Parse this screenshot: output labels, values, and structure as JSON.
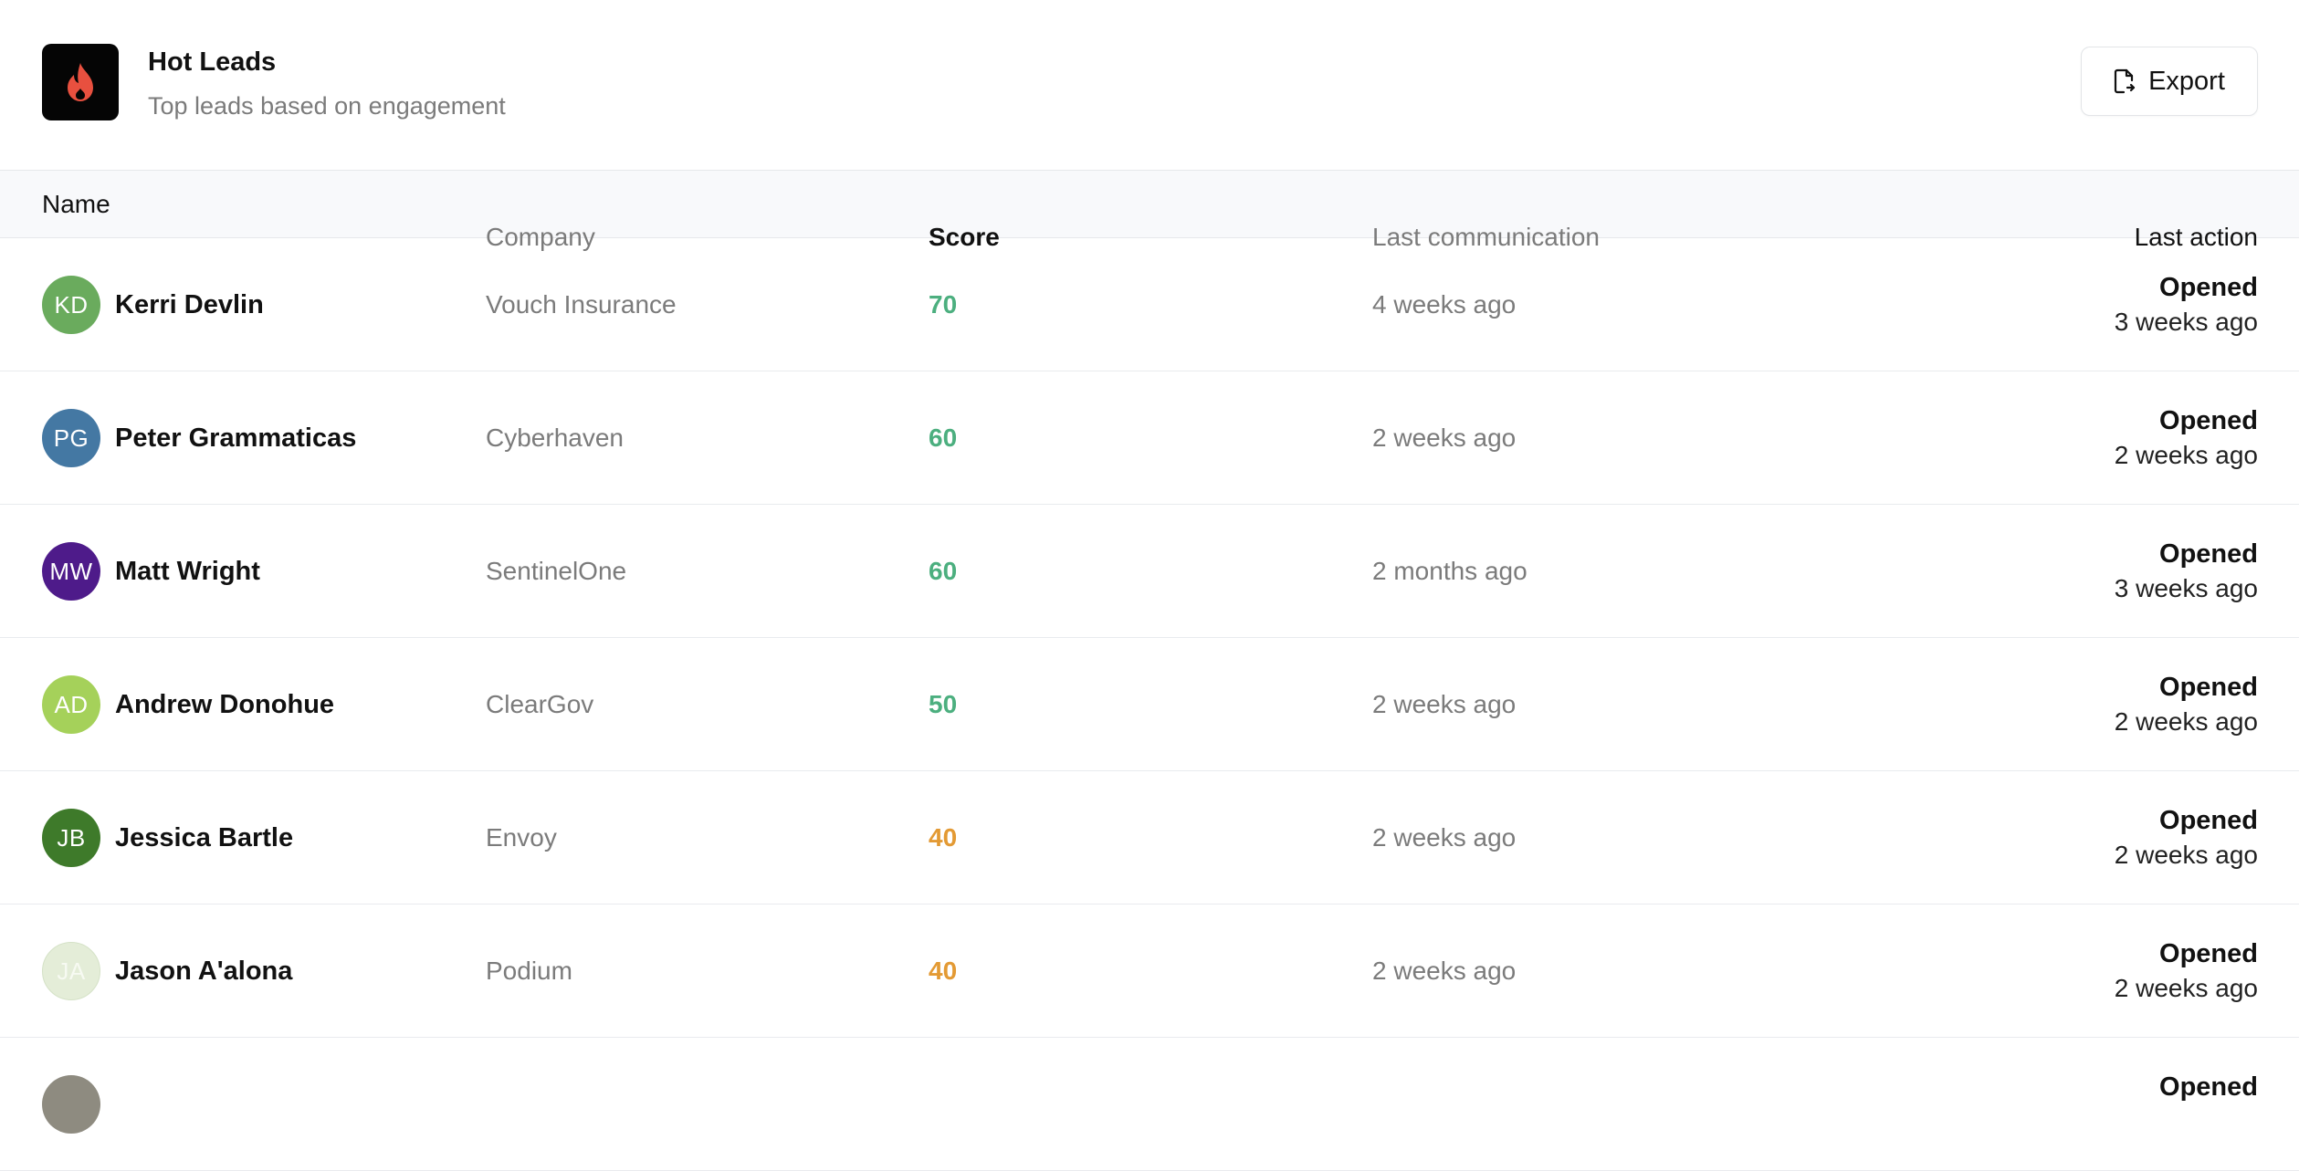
{
  "header": {
    "title": "Hot Leads",
    "subtitle": "Top leads based on engagement",
    "logo_icon": "flame-icon",
    "export_label": "Export",
    "export_icon": "file-export-icon"
  },
  "colors": {
    "score_high": "#4caf7f",
    "score_mid": "#e39a34",
    "logo_bg": "#050505",
    "flame": "#e8503f"
  },
  "columns": {
    "name": "Name",
    "company": "Company",
    "score": "Score",
    "last_communication": "Last communication",
    "last_action": "Last action"
  },
  "leads": [
    {
      "initials": "KD",
      "name": "Kerri Devlin",
      "company": "Vouch Insurance",
      "score": "70",
      "last_communication": "4 weeks ago",
      "action_type": "Opened",
      "action_time": "3 weeks ago"
    },
    {
      "initials": "PG",
      "name": "Peter Grammaticas",
      "company": "Cyberhaven",
      "score": "60",
      "last_communication": "2 weeks ago",
      "action_type": "Opened",
      "action_time": "2 weeks ago"
    },
    {
      "initials": "MW",
      "name": "Matt Wright",
      "company": "SentinelOne",
      "score": "60",
      "last_communication": "2 months ago",
      "action_type": "Opened",
      "action_time": "3 weeks ago"
    },
    {
      "initials": "AD",
      "name": "Andrew Donohue",
      "company": "ClearGov",
      "score": "50",
      "last_communication": "2 weeks ago",
      "action_type": "Opened",
      "action_time": "2 weeks ago"
    },
    {
      "initials": "JB",
      "name": "Jessica Bartle",
      "company": "Envoy",
      "score": "40",
      "last_communication": "2 weeks ago",
      "action_type": "Opened",
      "action_time": "2 weeks ago"
    },
    {
      "initials": "JA",
      "name": "Jason A'alona",
      "company": "Podium",
      "score": "40",
      "last_communication": "2 weeks ago",
      "action_type": "Opened",
      "action_time": "2 weeks ago"
    },
    {
      "initials": "",
      "name": "",
      "company": "",
      "score": "",
      "last_communication": "",
      "action_type": "Opened",
      "action_time": ""
    }
  ]
}
